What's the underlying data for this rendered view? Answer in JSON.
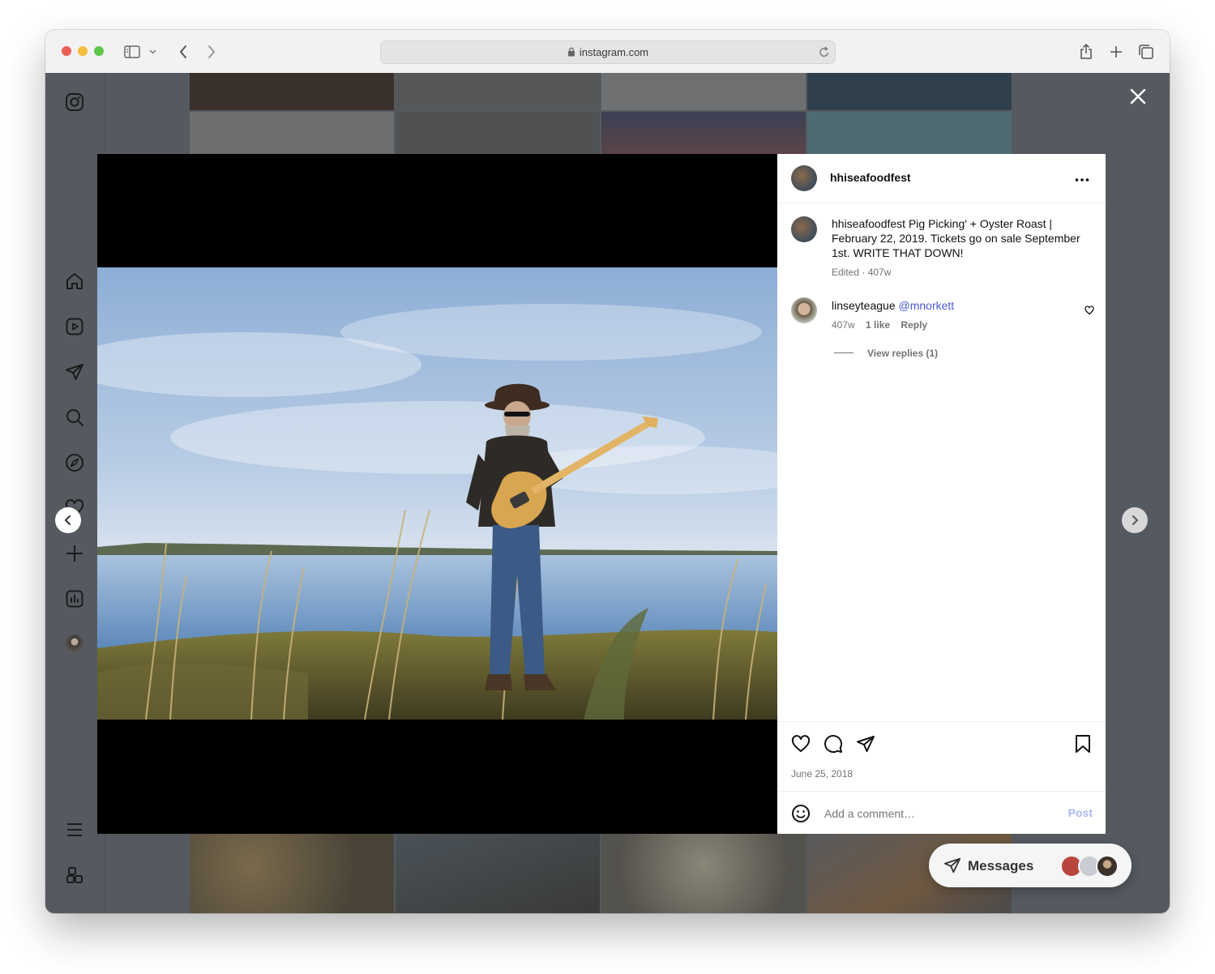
{
  "browser": {
    "url": "instagram.com"
  },
  "post": {
    "username": "hhiseafoodfest",
    "caption_user": "hhiseafoodfest",
    "caption_text": "Pig Picking' + Oyster Roast | February 22, 2019. Tickets go on sale September 1st. WRITE THAT DOWN!",
    "caption_meta": "Edited · 407w",
    "comment": {
      "user": "linseyteague",
      "mention": "@mnorkett",
      "time": "407w",
      "likes": "1 like",
      "reply": "Reply",
      "view_replies": "View replies (1)"
    },
    "date": "June 25, 2018",
    "add_comment_placeholder": "Add a comment…",
    "post_button": "Post"
  },
  "messages": {
    "label": "Messages"
  },
  "colors": {
    "accent_link": "#4a5bd4",
    "post_button": "#a8bbf0",
    "backdrop": "#555a60"
  },
  "icons": [
    "instagram-icon",
    "home-icon",
    "reels-icon",
    "direct-icon",
    "search-icon",
    "explore-icon",
    "heart-icon",
    "create-icon",
    "insights-icon",
    "menu-icon",
    "threads-icon"
  ]
}
